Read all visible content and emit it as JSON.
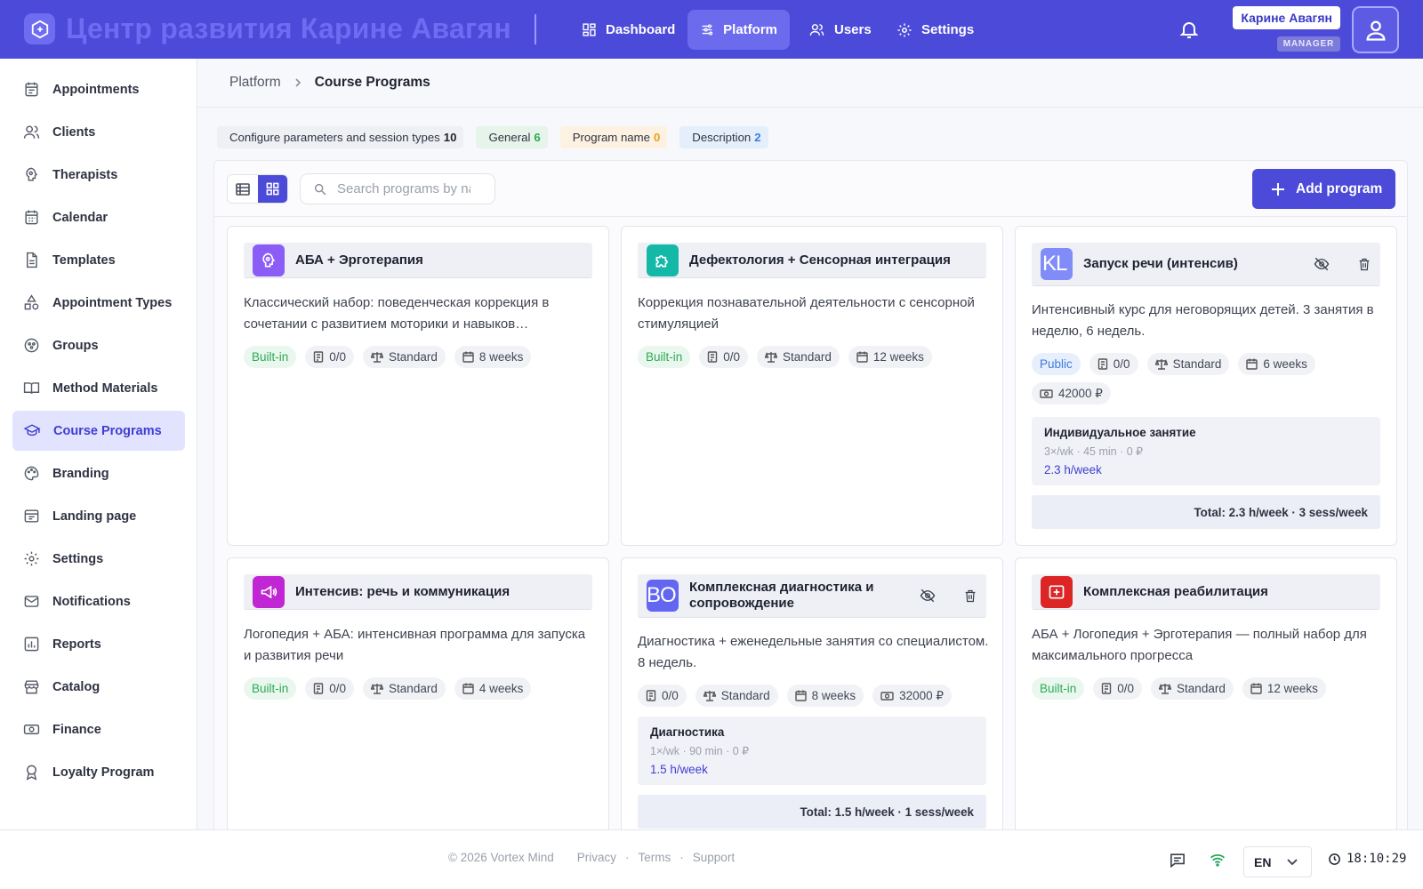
{
  "header": {
    "org_name": "Центр развития Карине Авагян",
    "nav": [
      {
        "label": "Dashboard",
        "icon": "grid-icon"
      },
      {
        "label": "Platform",
        "icon": "sliders-icon",
        "active": true
      },
      {
        "label": "Users",
        "icon": "users-icon"
      },
      {
        "label": "Settings",
        "icon": "gear-icon"
      }
    ],
    "user_name": "Карине Авагян",
    "user_role": "MANAGER"
  },
  "sidebar": {
    "items": [
      {
        "label": "Appointments",
        "icon": "calendar-list-icon"
      },
      {
        "label": "Clients",
        "icon": "users-icon"
      },
      {
        "label": "Therapists",
        "icon": "brain-icon"
      },
      {
        "label": "Calendar",
        "icon": "calendar-icon"
      },
      {
        "label": "Templates",
        "icon": "document-icon"
      },
      {
        "label": "Appointment Types",
        "icon": "shapes-icon"
      },
      {
        "label": "Groups",
        "icon": "group-icon"
      },
      {
        "label": "Method Materials",
        "icon": "book-icon"
      },
      {
        "label": "Course Programs",
        "icon": "graduation-cap-icon",
        "active": true
      },
      {
        "label": "Branding",
        "icon": "palette-icon"
      },
      {
        "label": "Landing page",
        "icon": "browser-icon"
      },
      {
        "label": "Settings",
        "icon": "gear-icon"
      },
      {
        "label": "Notifications",
        "icon": "mail-icon"
      },
      {
        "label": "Reports",
        "icon": "bar-chart-icon"
      },
      {
        "label": "Catalog",
        "icon": "store-icon"
      },
      {
        "label": "Finance",
        "icon": "money-icon"
      },
      {
        "label": "Loyalty Program",
        "icon": "award-icon"
      }
    ]
  },
  "breadcrumb": {
    "parent": "Platform",
    "current": "Course Programs"
  },
  "stats": [
    {
      "label": "Configure parameters and session types",
      "count": "10",
      "bg": "#eef0f4",
      "color": "#1f2330"
    },
    {
      "label": "General",
      "count": "6",
      "bg": "#e6f4ea",
      "color": "#2fa956"
    },
    {
      "label": "Program name",
      "count": "0",
      "bg": "#fdf1e1",
      "color": "#e8a21f"
    },
    {
      "label": "Description",
      "count": "2",
      "bg": "#e5effb",
      "color": "#3d7be0"
    }
  ],
  "toolbar": {
    "search_placeholder": "Search programs by name...",
    "add_label": "Add program"
  },
  "cards": [
    {
      "title": "АБА + Эрготерапия",
      "icon": "brain-icon",
      "icon_bg": "#8b5cf6",
      "description": "Классический набор: поведенческая коррекция в сочетании с развитием моторики и навыков…",
      "tags": [
        {
          "text": "Built-in",
          "kind": "green"
        },
        {
          "text": "0/0",
          "icon": "doc"
        },
        {
          "text": "Standard",
          "icon": "scale"
        },
        {
          "text": "8 weeks",
          "icon": "cal"
        }
      ]
    },
    {
      "title": "Дефектология + Сенсорная интеграция",
      "icon": "puzzle-icon",
      "icon_bg": "#14b8a6",
      "description": "Коррекция познавательной деятельности с сенсорной стимуляцией",
      "tags": [
        {
          "text": "Built-in",
          "kind": "green"
        },
        {
          "text": "0/0",
          "icon": "doc"
        },
        {
          "text": "Standard",
          "icon": "scale"
        },
        {
          "text": "12 weeks",
          "icon": "cal"
        }
      ]
    },
    {
      "title": "Запуск речи (интенсив)",
      "icon": "letters-icon",
      "icon_bg": "#818cf8",
      "icon_text": "KL",
      "description": "Интенсивный курс для неговорящих детей. 3 занятия в неделю, 6 недель.",
      "tags": [
        {
          "text": "Public",
          "kind": "blue"
        },
        {
          "text": "0/0",
          "icon": "doc"
        },
        {
          "text": "Standard",
          "icon": "scale"
        },
        {
          "text": "6 weeks",
          "icon": "cal"
        },
        {
          "text": "42000 ₽",
          "icon": "money"
        }
      ],
      "sessions": [
        {
          "name": "Индивидуальное занятие",
          "meta": "3×/wk · 45 min · 0 ₽",
          "hours": "2.3 h/week"
        }
      ],
      "total": "Total: 2.3 h/week · 3 sess/week"
    },
    {
      "title": "Интенсив: речь и коммуникация",
      "icon": "megaphone-icon",
      "icon_bg": "#c026d3",
      "description": "Логопедия + АБА: интенсивная программа для запуска и развития речи",
      "tags": [
        {
          "text": "Built-in",
          "kind": "green"
        },
        {
          "text": "0/0",
          "icon": "doc"
        },
        {
          "text": "Standard",
          "icon": "scale"
        },
        {
          "text": "4 weeks",
          "icon": "cal"
        }
      ]
    },
    {
      "title": "Комплексная диагностика и сопровождение",
      "icon": "letters-icon",
      "icon_bg": "#6366f1",
      "icon_text": "BO",
      "description": "Диагностика + еженедельные занятия со специалистом. 8 недель.",
      "tags": [
        {
          "text": "0/0",
          "icon": "doc"
        },
        {
          "text": "Standard",
          "icon": "scale"
        },
        {
          "text": "8 weeks",
          "icon": "cal"
        },
        {
          "text": "32000 ₽",
          "icon": "money"
        }
      ],
      "sessions": [
        {
          "name": "Диагностика",
          "meta": "1×/wk · 90 min · 0 ₽",
          "hours": "1.5 h/week"
        }
      ],
      "total": "Total: 1.5 h/week · 1 sess/week"
    },
    {
      "title": "Комплексная реабилитация",
      "icon": "medical-cross-icon",
      "icon_bg": "#dc2626",
      "description": "АБА + Логопедия + Эрготерапия — полный набор для максимального прогресса",
      "tags": [
        {
          "text": "Built-in",
          "kind": "green"
        },
        {
          "text": "0/0",
          "icon": "doc"
        },
        {
          "text": "Standard",
          "icon": "scale"
        },
        {
          "text": "12 weeks",
          "icon": "cal"
        }
      ]
    }
  ],
  "footer": {
    "copyright": "© 2026 Vortex Mind",
    "links": [
      "Privacy",
      "Terms",
      "Support"
    ],
    "language": "EN",
    "time": "18:10:29"
  }
}
